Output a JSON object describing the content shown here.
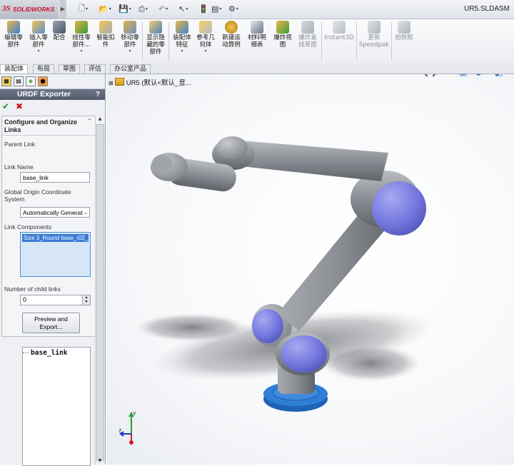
{
  "app": {
    "brand_ds": "3S",
    "brand_name": "SOLIDWORKS",
    "document_title": "UR5.SLDASM"
  },
  "quick_access": [
    "new-icon",
    "open-icon",
    "save-icon",
    "print-icon",
    "undo-icon",
    "select-icon",
    "rebuild-icon",
    "options-icon"
  ],
  "ribbon": {
    "edit_part": "编辑零\n部件",
    "insert_part": "插入零\n部件",
    "mate": "配合",
    "linear_pattern": "线性零\n部件...",
    "smart_fasteners": "智能扣\n件",
    "move_component": "移动零\n部件",
    "show_hidden": "显示隐\n藏的零\n部件",
    "assembly_features": "装配体\n特征",
    "reference_geometry": "参考几\n何体",
    "new_motion_study": "新建运\n动算例",
    "bom": "材料明\n细表",
    "exploded_view": "爆炸视\n图",
    "explode_line_sketch": "爆炸直\n线草图",
    "instant3d": "Instant3D",
    "update_speedpak": "更新\nSpeedpak",
    "take_snapshot": "拍快照"
  },
  "tabs": [
    "装配体",
    "布局",
    "草图",
    "评估",
    "办公室产品"
  ],
  "property_manager": {
    "title": "URDF Exporter",
    "help": "?",
    "group_title": "Configure and Organize Links",
    "parent_link_label": "Parent Link",
    "link_name_label": "Link Name",
    "link_name_value": "base_link",
    "origin_label": "Global Origin Coordinate System",
    "origin_value": "Automatically Generat",
    "components_label": "Link Components",
    "component_item": "Size 3_Round base_r02_",
    "child_links_label": "Number of child links",
    "child_links_value": "0",
    "preview_button": "Preview and\nExport..."
  },
  "tree": {
    "root": "base_link"
  },
  "feature_manager": {
    "root": "UR5  (默认<默认_显..."
  },
  "colors": {
    "accent": "#3a7bd5",
    "robot_gray": "#8e9197",
    "joint_cap": "#7b7fe0",
    "base_blue": "#2f7fd6"
  }
}
